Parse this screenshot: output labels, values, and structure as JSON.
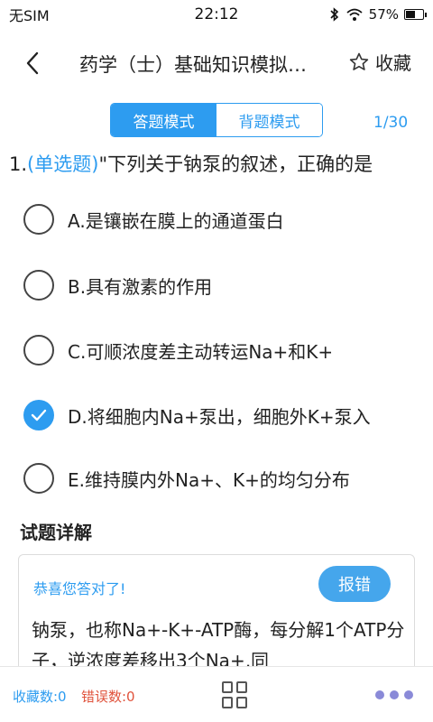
{
  "status_bar": {
    "carrier": "无SIM",
    "time": "22:12",
    "battery": "57%",
    "battery_level": 0.57
  },
  "header": {
    "title": "药学（士）基础知识模拟…",
    "favorite_label": "收藏"
  },
  "mode": {
    "answer_mode": "答题模式",
    "recite_mode": "背题模式",
    "active": "answer_mode"
  },
  "progress": "1/30",
  "question": {
    "number": "1.",
    "type": "(单选题)",
    "text": "\"下列关于钠泵的叙述，正确的是"
  },
  "options": [
    {
      "label": "A.是镶嵌在膜上的通道蛋白",
      "checked": false
    },
    {
      "label": "B.具有激素的作用",
      "checked": false
    },
    {
      "label": "C.可顺浓度差主动转运Na+和K+",
      "checked": false
    },
    {
      "label": "D.将细胞内Na+泵出，细胞外K+泵入",
      "checked": true
    },
    {
      "label": "E.维持膜内外Na+、K+的均匀分布",
      "checked": false
    }
  ],
  "detail": {
    "title": "试题详解",
    "result": "恭喜您答对了!",
    "report_label": "报错",
    "explanation": "钠泵，也称Na+-K+-ATP酶，每分解1个ATP分子，逆浓度差移出3个Na+,同"
  },
  "bottom_bar": {
    "favorites": "收藏数:0",
    "errors": "错误数:0"
  },
  "colors": {
    "accent": "#2d9cf0",
    "error": "#e0533c"
  }
}
